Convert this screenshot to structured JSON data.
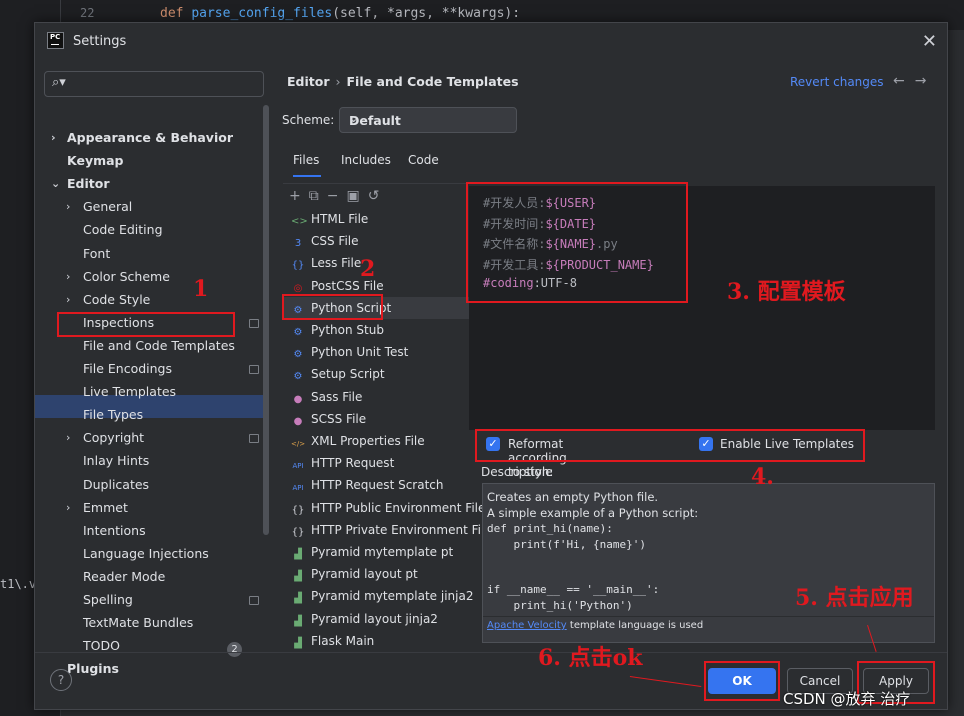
{
  "background": {
    "line_number": "22",
    "code_def": "def",
    "code_fn": "parse_config_files",
    "code_rest": "(self, *args, **kwargs):",
    "side_text": "t1\\.v"
  },
  "dialog": {
    "app_icon": "PC",
    "title": "Settings",
    "search_placeholder": ""
  },
  "tree": {
    "items": [
      {
        "label": "Appearance & Behavior",
        "bold": true,
        "chevron": "right"
      },
      {
        "label": "Keymap",
        "bold": true
      },
      {
        "label": "Editor",
        "bold": true,
        "chevron": "down"
      },
      {
        "label": "General",
        "chevron": "right"
      },
      {
        "label": "Code Editing"
      },
      {
        "label": "Font"
      },
      {
        "label": "Color Scheme",
        "chevron": "right"
      },
      {
        "label": "Code Style",
        "chevron": "right"
      },
      {
        "label": "Inspections"
      },
      {
        "label": "File and Code Templates",
        "selected": true
      },
      {
        "label": "File Encodings"
      },
      {
        "label": "Live Templates"
      },
      {
        "label": "File Types"
      },
      {
        "label": "Copyright",
        "chevron": "right"
      },
      {
        "label": "Inlay Hints"
      },
      {
        "label": "Duplicates"
      },
      {
        "label": "Emmet",
        "chevron": "right"
      },
      {
        "label": "Intentions"
      },
      {
        "label": "Language Injections"
      },
      {
        "label": "Reader Mode"
      },
      {
        "label": "Spelling"
      },
      {
        "label": "TextMate Bundles"
      },
      {
        "label": "TODO"
      },
      {
        "label": "Plugins",
        "bold": true
      }
    ],
    "plugins_badge": "2"
  },
  "header": {
    "crumb_parent": "Editor",
    "crumb_sep": "›",
    "crumb_current": "File and Code Templates",
    "revert_label": "Revert changes",
    "back_arrow": "←",
    "forward_arrow": "→"
  },
  "scheme": {
    "label": "Scheme:",
    "value": "Default"
  },
  "tabs": [
    "Files",
    "Includes",
    "Code"
  ],
  "files": [
    {
      "label": "HTML File",
      "icon": "html-icon",
      "color": "#6aab73"
    },
    {
      "label": "CSS File",
      "icon": "css-icon",
      "color": "#548af7"
    },
    {
      "label": "Less File",
      "icon": "less-icon",
      "color": "#548af7"
    },
    {
      "label": "PostCSS File",
      "icon": "postcss-icon",
      "color": "#e0191f"
    },
    {
      "label": "Python Script",
      "icon": "python-icon",
      "color": "#548af7",
      "selected": true
    },
    {
      "label": "Python Stub",
      "icon": "python-icon",
      "color": "#548af7"
    },
    {
      "label": "Python Unit Test",
      "icon": "python-icon",
      "color": "#548af7"
    },
    {
      "label": "Setup Script",
      "icon": "python-icon",
      "color": "#548af7"
    },
    {
      "label": "Sass File",
      "icon": "sass-icon",
      "color": "#c77dbb"
    },
    {
      "label": "SCSS File",
      "icon": "scss-icon",
      "color": "#c77dbb"
    },
    {
      "label": "XML Properties File",
      "icon": "xml-icon",
      "color": "#e0a44c"
    },
    {
      "label": "HTTP Request",
      "icon": "api-icon",
      "color": "#548af7"
    },
    {
      "label": "HTTP Request Scratch",
      "icon": "api-icon",
      "color": "#548af7"
    },
    {
      "label": "HTTP Public Environment File",
      "icon": "braces-icon",
      "color": "#ced0d6"
    },
    {
      "label": "HTTP Private Environment File",
      "icon": "braces-icon",
      "color": "#ced0d6"
    },
    {
      "label": "Pyramid mytemplate pt",
      "icon": "pyramid-icon",
      "color": "#6aab73"
    },
    {
      "label": "Pyramid layout pt",
      "icon": "pyramid-icon",
      "color": "#6aab73"
    },
    {
      "label": "Pyramid mytemplate jinja2",
      "icon": "pyramid-icon",
      "color": "#6aab73"
    },
    {
      "label": "Pyramid layout jinja2",
      "icon": "pyramid-icon",
      "color": "#6aab73"
    },
    {
      "label": "Flask Main",
      "icon": "pyramid-icon",
      "color": "#6aab73"
    }
  ],
  "template": {
    "lines": [
      {
        "label": "#开发人员:",
        "value": "${USER}"
      },
      {
        "label": "#开发时间:",
        "value": "${DATE}"
      },
      {
        "label": "#文件名称:",
        "value": "${NAME}",
        "suffix": ".py"
      },
      {
        "label": "#开发工具:",
        "value": "${PRODUCT_NAME}"
      },
      {
        "label": "#coding",
        "value": ":UTF-8"
      }
    ]
  },
  "options": {
    "reformat_label": "Reformat according to style",
    "live_templates_label": "Enable Live Templates",
    "check_mark": "✓"
  },
  "description": {
    "label": "Description:",
    "line1": "Creates an empty Python file.",
    "line2": "A simple example of a Python script:",
    "code1": "def print_hi(name):",
    "code2": "    print(f'Hi, {name}')",
    "code3": "if __name__ == '__main__':",
    "code4": "    print_hi('Python')",
    "footer_link": "Apache Velocity",
    "footer_text": " template language is used"
  },
  "buttons": {
    "help": "?",
    "ok": "OK",
    "cancel": "Cancel",
    "apply": "Apply"
  },
  "annotations": {
    "a1": "1",
    "a2": "2",
    "a3": "3. 配置模板",
    "a4": "4.",
    "a5": "5. 点击应用",
    "a6": "6. 点击ok"
  },
  "watermark": "CSDN @放弃     治疗"
}
